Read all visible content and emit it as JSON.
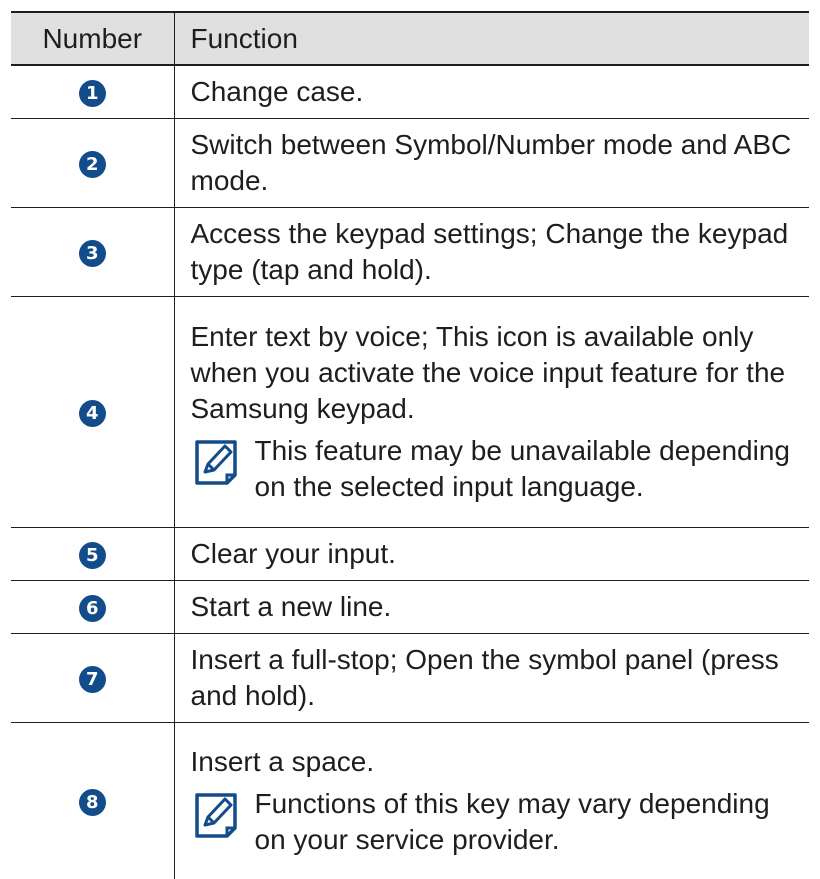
{
  "table": {
    "header": {
      "number": "Number",
      "function": "Function"
    },
    "rows": [
      {
        "num": "1",
        "text": "Change case.",
        "note": ""
      },
      {
        "num": "2",
        "text": "Switch between Symbol/Number mode and ABC mode.",
        "note": ""
      },
      {
        "num": "3",
        "text": "Access the keypad settings; Change the keypad type (tap and hold).",
        "note": ""
      },
      {
        "num": "4",
        "text": "Enter text by voice; This icon is available only when you activate the voice input feature for the Samsung keypad.",
        "note": "This feature may be unavailable depending on the selected input language."
      },
      {
        "num": "5",
        "text": "Clear your input.",
        "note": ""
      },
      {
        "num": "6",
        "text": "Start a new line.",
        "note": ""
      },
      {
        "num": "7",
        "text": "Insert a full-stop; Open the symbol panel (press and hold).",
        "note": ""
      },
      {
        "num": "8",
        "text": "Insert a space.",
        "note": "Functions of this key may vary depending on your service provider."
      }
    ]
  },
  "colors": {
    "badge": "#124c8a",
    "header_bg": "#e0e0e0",
    "text": "#1e1e1e"
  },
  "icons": {
    "note": "note-pencil-icon"
  }
}
